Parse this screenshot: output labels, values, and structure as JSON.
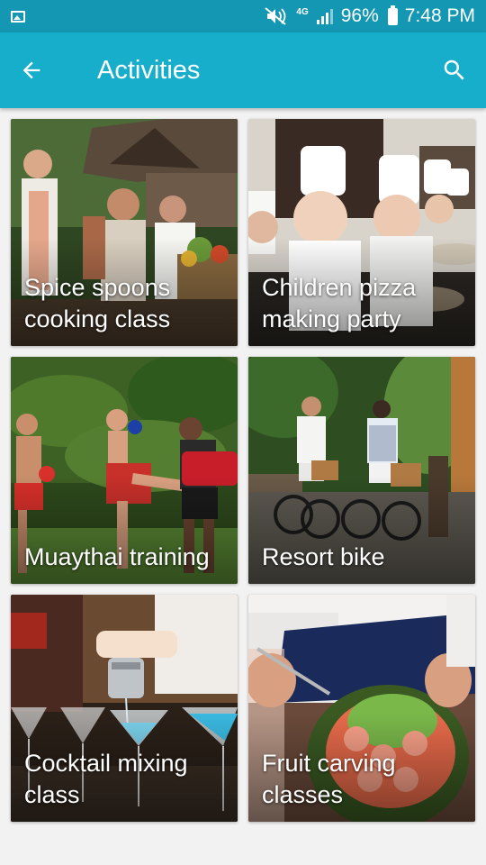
{
  "status_bar": {
    "network": "4G",
    "battery": "96%",
    "time": "7:48 PM"
  },
  "app_bar": {
    "title": "Activities",
    "back_icon": "arrow-back-icon",
    "search_icon": "search-icon"
  },
  "colors": {
    "status_bar": "#1497b2",
    "app_bar": "#17aecb",
    "background": "#f2f2f2"
  },
  "activities": [
    {
      "label": "Spice spoons cooking class"
    },
    {
      "label": "Children pizza making party"
    },
    {
      "label": "Muaythai training"
    },
    {
      "label": "Resort bike"
    },
    {
      "label": "Cocktail mixing class"
    },
    {
      "label": "Fruit carving classes"
    }
  ]
}
